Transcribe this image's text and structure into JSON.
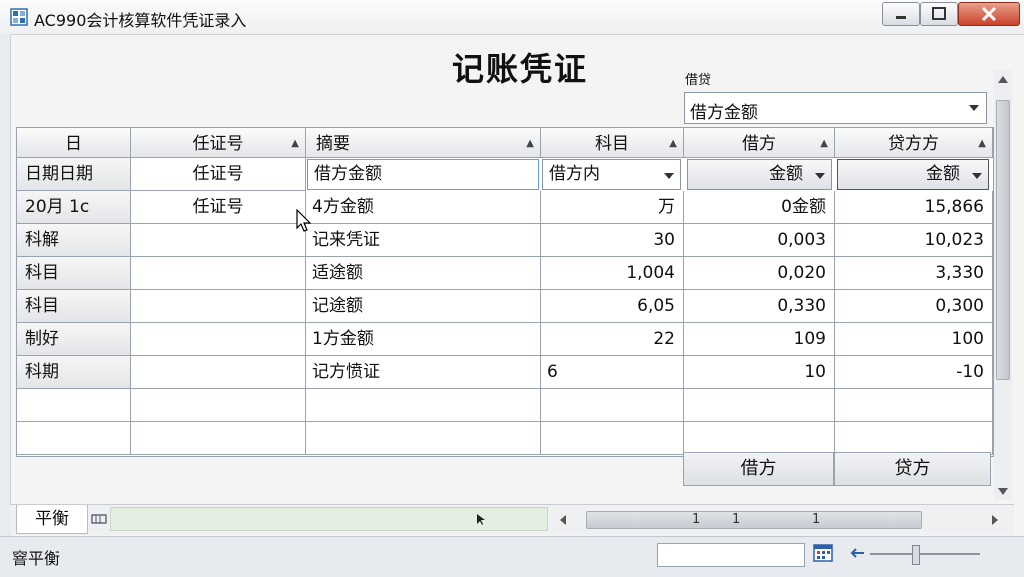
{
  "window": {
    "title": "AC990会计核算软件凭证录入",
    "controls": [
      "minimize-icon",
      "maximize-icon",
      "close-icon"
    ]
  },
  "doc": {
    "title": "记账凭证",
    "small_label": "借贷",
    "combo_value": "借方金额"
  },
  "grid": {
    "headers": [
      "日",
      "任证号",
      "摘要",
      "科目",
      "借方",
      "贷方方"
    ],
    "edit_row": {
      "c0": "日期日期",
      "c1": "任证号",
      "c2": "借方金额",
      "c3": "借方内",
      "c4": "金额",
      "c5": "金额"
    },
    "rows": [
      [
        "20月 1c",
        "任证号",
        "4方金额",
        "万",
        "0金额",
        "15,866"
      ],
      [
        "科解",
        "",
        "记来凭证",
        "30",
        "0,003",
        "10,023"
      ],
      [
        "科目",
        "",
        "适途额",
        "1,004",
        "0,020",
        "3,330"
      ],
      [
        "科目",
        "",
        "记途额",
        "6,05",
        "0,330",
        "0,300"
      ],
      [
        "制好",
        "",
        "1方金额",
        "22",
        "109",
        "100"
      ],
      [
        "科期",
        "",
        "记方愤证",
        "6",
        "10",
        "-10"
      ],
      [
        "",
        "",
        "",
        "",
        "",
        ""
      ],
      [
        "",
        "",
        "",
        "",
        "",
        ""
      ]
    ],
    "totals": [
      "借方",
      "贷方"
    ]
  },
  "sheetbar": {
    "active_tab": "平衡",
    "hscroll_marks": [
      "1",
      "1",
      "1"
    ]
  },
  "status": {
    "text": "窨平衡"
  }
}
